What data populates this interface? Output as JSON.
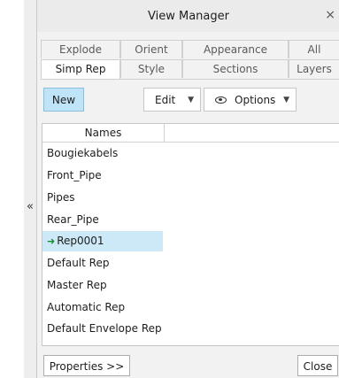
{
  "dialog": {
    "title": "View Manager",
    "close_glyph": "×"
  },
  "side": {
    "collapse_glyph": "«"
  },
  "tabs_row1": [
    {
      "label": "Explode"
    },
    {
      "label": "Orient"
    },
    {
      "label": "Appearance"
    },
    {
      "label": "All"
    }
  ],
  "tabs_row2": [
    {
      "label": "Simp Rep",
      "active": true
    },
    {
      "label": "Style"
    },
    {
      "label": "Sections"
    },
    {
      "label": "Layers"
    }
  ],
  "toolbar": {
    "new_label": "New",
    "edit_label": "Edit",
    "options_label": "Options",
    "dropdown_glyph": "▼",
    "options_icon": "eye-icon"
  },
  "list": {
    "column_header": "Names",
    "items": [
      {
        "label": "Bougiekabels"
      },
      {
        "label": "Front_Pipe"
      },
      {
        "label": "Pipes"
      },
      {
        "label": "Rear_Pipe"
      },
      {
        "label": "Rep0001",
        "selected": true,
        "active_icon": "green-arrow-icon"
      },
      {
        "label": "Default Rep"
      },
      {
        "label": "Master Rep"
      },
      {
        "label": "Automatic Rep"
      },
      {
        "label": "Default Envelope Rep"
      }
    ]
  },
  "footer": {
    "properties_label": "Properties >>",
    "close_label": "Close"
  },
  "colors": {
    "selection": "#cde8f6",
    "primary_button": "#bfe4f7",
    "active_arrow": "#1c8c36"
  }
}
